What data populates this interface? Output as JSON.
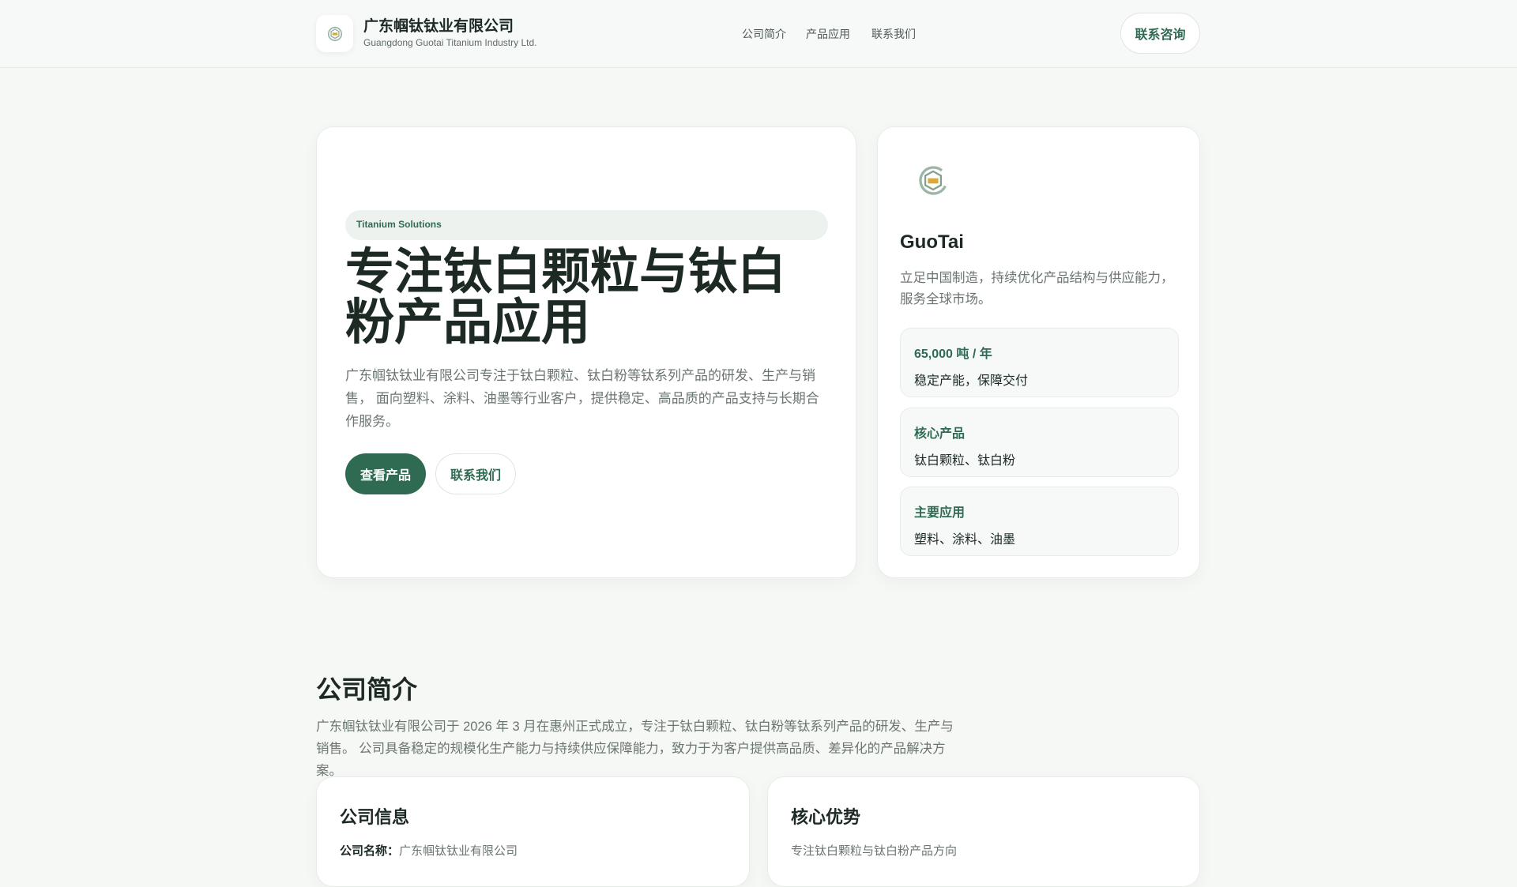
{
  "header": {
    "company_name": "广东帼钛钛业有限公司",
    "company_name_en": "Guangdong Guotai Titanium Industry Ltd.",
    "nav": [
      "公司简介",
      "产品应用",
      "联系我们"
    ],
    "contact_button": "联系咨询"
  },
  "hero": {
    "badge": "Titanium Solutions",
    "heading": "专注钛白颗粒与钛白粉产品应用",
    "description": "广东帼钛钛业有限公司专注于钛白颗粒、钛白粉等钛系列产品的研发、生产与销售， 面向塑料、涂料、油墨等行业客户，提供稳定、高品质的产品支持与长期合作服务。",
    "primary_button": "查看产品",
    "secondary_button": "联系我们"
  },
  "side_card": {
    "title": "GuoTai",
    "description": "立足中国制造，持续优化产品结构与供应能力，服务全球市场。",
    "stats": [
      {
        "label": "65,000 吨 / 年",
        "value": "稳定产能，保障交付"
      },
      {
        "label": "核心产品",
        "value": "钛白颗粒、钛白粉"
      },
      {
        "label": "主要应用",
        "value": "塑料、涂料、油墨"
      }
    ]
  },
  "about": {
    "title": "公司简介",
    "text": "广东帼钛钛业有限公司于 2026 年 3 月在惠州正式成立，专注于钛白颗粒、钛白粉等钛系列产品的研发、生产与销售。 公司具备稳定的规模化生产能力与持续供应保障能力，致力于为客户提供高品质、差异化的产品解决方案。",
    "info_card": {
      "title": "公司信息",
      "name_label": "公司名称：",
      "name_value": "广东帼钛钛业有限公司"
    },
    "advantage_card": {
      "title": "核心优势",
      "first_item": "专注钛白颗粒与钛白粉产品方向"
    }
  },
  "colors": {
    "accent": "#2f6b52",
    "background": "#f6f8f6",
    "logo_gold": "#d9a93a"
  }
}
